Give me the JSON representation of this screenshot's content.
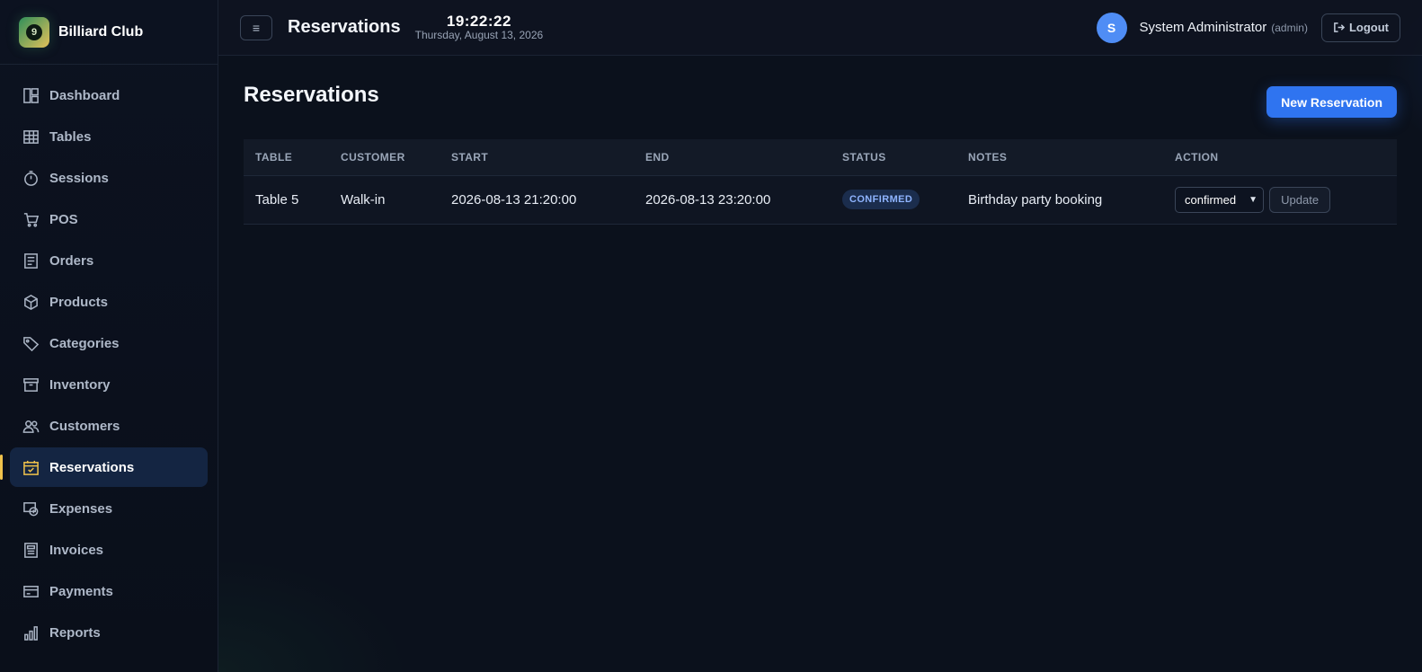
{
  "brand": {
    "name": "Billiard Club",
    "logo_glyph": "9"
  },
  "sidebar": {
    "items": [
      {
        "label": "Dashboard",
        "icon": "dashboard-icon"
      },
      {
        "label": "Tables",
        "icon": "tables-icon"
      },
      {
        "label": "Sessions",
        "icon": "stopwatch-icon"
      },
      {
        "label": "POS",
        "icon": "cart-icon"
      },
      {
        "label": "Orders",
        "icon": "receipt-icon"
      },
      {
        "label": "Products",
        "icon": "box-icon"
      },
      {
        "label": "Categories",
        "icon": "tag-icon"
      },
      {
        "label": "Inventory",
        "icon": "archive-icon"
      },
      {
        "label": "Customers",
        "icon": "users-icon"
      },
      {
        "label": "Reservations",
        "icon": "calendar-check-icon",
        "active": true
      },
      {
        "label": "Expenses",
        "icon": "cash-icon"
      },
      {
        "label": "Invoices",
        "icon": "invoice-icon"
      },
      {
        "label": "Payments",
        "icon": "card-icon"
      },
      {
        "label": "Reports",
        "icon": "bar-chart-icon"
      }
    ]
  },
  "topbar": {
    "menu_glyph": "≡",
    "title": "Reservations",
    "time": "19:22:22",
    "date": "Thursday, August 13, 2026",
    "avatar_initial": "S",
    "user_name": "System Administrator",
    "user_role": "(admin)",
    "logout_label": "Logout"
  },
  "page": {
    "title": "Reservations",
    "new_button": "New Reservation"
  },
  "table": {
    "columns": [
      "TABLE",
      "CUSTOMER",
      "START",
      "END",
      "STATUS",
      "NOTES",
      "ACTION"
    ],
    "rows": [
      {
        "table": "Table 5",
        "customer": "Walk-in",
        "start": "2026-08-13 21:20:00",
        "end": "2026-08-13 23:20:00",
        "status": "CONFIRMED",
        "notes": "Birthday party booking",
        "select_value": "confirmed",
        "update_label": "Update"
      }
    ]
  },
  "colors": {
    "accent": "#2f74f0",
    "active_marker": "#f0c24b",
    "badge_text": "#8fb4ff",
    "avatar": "#4f8df5"
  }
}
